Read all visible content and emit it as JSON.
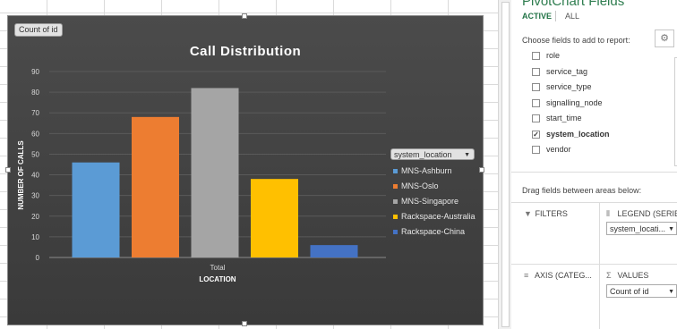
{
  "pane": {
    "title": "PivotChart Fields",
    "tab_active": "ACTIVE",
    "tab_all": "ALL",
    "choose_label": "Choose fields to add to report:",
    "gear_icon": "gear-icon",
    "fields": [
      {
        "label": "role",
        "checked": false
      },
      {
        "label": "service_tag",
        "checked": false
      },
      {
        "label": "service_type",
        "checked": false
      },
      {
        "label": "signalling_node",
        "checked": false
      },
      {
        "label": "start_time",
        "checked": false
      },
      {
        "label": "system_location",
        "checked": true
      },
      {
        "label": "vendor",
        "checked": false
      }
    ],
    "drag_label": "Drag fields between areas below:",
    "areas": {
      "filters": {
        "label": "FILTERS",
        "icon": "filter-icon"
      },
      "legend": {
        "label": "LEGEND (SERIES)",
        "icon": "columns-icon",
        "value": "system_locati..."
      },
      "axis": {
        "label": "AXIS (CATEG...",
        "icon": "rows-icon"
      },
      "values": {
        "label": "VALUES",
        "icon": "sigma-icon",
        "value": "Count of id"
      }
    }
  },
  "chart": {
    "field_button": "Count of id",
    "legend_dropdown": "system_location",
    "legend_items": [
      {
        "label": "MNS-Ashburn",
        "color": "#5b9bd5"
      },
      {
        "label": "MNS-Oslo",
        "color": "#ed7d31"
      },
      {
        "label": "MNS-Singapore",
        "color": "#a5a5a5"
      },
      {
        "label": "Rackspace-Australia",
        "color": "#ffc000"
      },
      {
        "label": "Rackspace-China",
        "color": "#4472c4"
      }
    ]
  },
  "chart_data": {
    "type": "bar",
    "title": "Call Distribution",
    "xlabel": "LOCATION",
    "ylabel": "NUMBER OF CALLS",
    "categories": [
      "Total"
    ],
    "ylim": [
      0,
      90
    ],
    "yticks": [
      0,
      10,
      20,
      30,
      40,
      50,
      60,
      70,
      80,
      90
    ],
    "grid": true,
    "legend_position": "right",
    "series": [
      {
        "name": "MNS-Ashburn",
        "values": [
          46
        ],
        "color": "#5b9bd5"
      },
      {
        "name": "MNS-Oslo",
        "values": [
          68
        ],
        "color": "#ed7d31"
      },
      {
        "name": "MNS-Singapore",
        "values": [
          82
        ],
        "color": "#a5a5a5"
      },
      {
        "name": "Rackspace-Australia",
        "values": [
          38
        ],
        "color": "#ffc000"
      },
      {
        "name": "Rackspace-China",
        "values": [
          6
        ],
        "color": "#4472c4"
      }
    ]
  }
}
